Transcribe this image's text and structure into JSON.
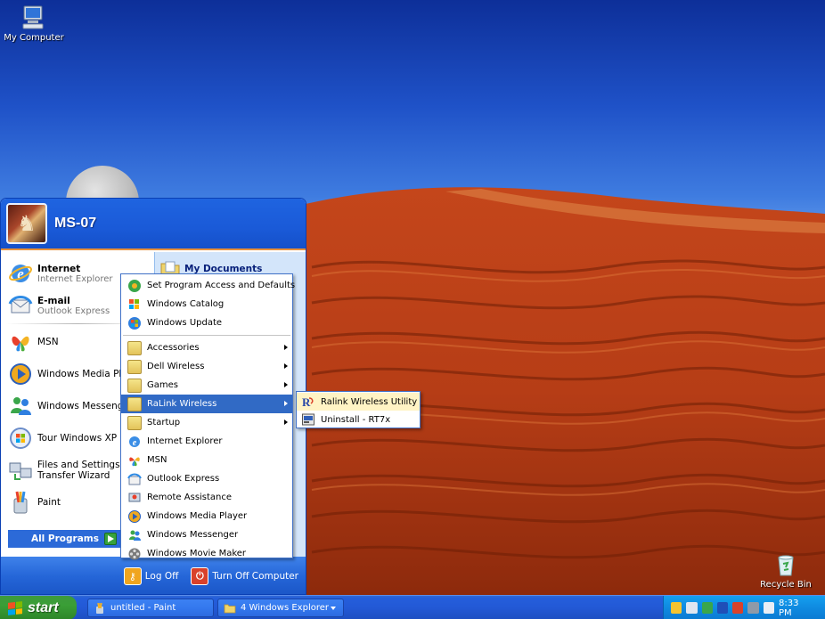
{
  "desktop": {
    "icons": [
      {
        "label": "My Computer"
      },
      {
        "label": "Recycle Bin"
      }
    ]
  },
  "start_menu": {
    "user": "MS-07",
    "pinned": [
      {
        "title": "Internet",
        "subtitle": "Internet Explorer"
      },
      {
        "title": "E-mail",
        "subtitle": "Outlook Express"
      }
    ],
    "recent": [
      {
        "title": "MSN"
      },
      {
        "title": "Windows Media Player"
      },
      {
        "title": "Windows Messenger"
      },
      {
        "title": "Tour Windows XP"
      },
      {
        "title": "Files and Settings Transfer Wizard"
      },
      {
        "title": "Paint"
      }
    ],
    "all_programs": "All Programs",
    "right_top": "My Documents",
    "log_off": "Log Off",
    "turn_off": "Turn Off Computer"
  },
  "programs_menu": {
    "items": [
      {
        "label": "Set Program Access and Defaults"
      },
      {
        "label": "Windows Catalog"
      },
      {
        "label": "Windows Update"
      },
      {
        "label": "Accessories"
      },
      {
        "label": "Dell Wireless"
      },
      {
        "label": "Games"
      },
      {
        "label": "RaLink Wireless"
      },
      {
        "label": "Startup"
      },
      {
        "label": "Internet Explorer"
      },
      {
        "label": "MSN"
      },
      {
        "label": "Outlook Express"
      },
      {
        "label": "Remote Assistance"
      },
      {
        "label": "Windows Media Player"
      },
      {
        "label": "Windows Messenger"
      },
      {
        "label": "Windows Movie Maker"
      }
    ]
  },
  "ralink_submenu": {
    "items": [
      {
        "label": "Ralink Wireless Utility"
      },
      {
        "label": "Uninstall - RT7x"
      }
    ]
  },
  "taskbar": {
    "start_label": "start",
    "tasks": [
      {
        "label": "untitled - Paint"
      },
      {
        "label": "4 Windows Explorer"
      }
    ],
    "clock": "8:33 PM"
  }
}
